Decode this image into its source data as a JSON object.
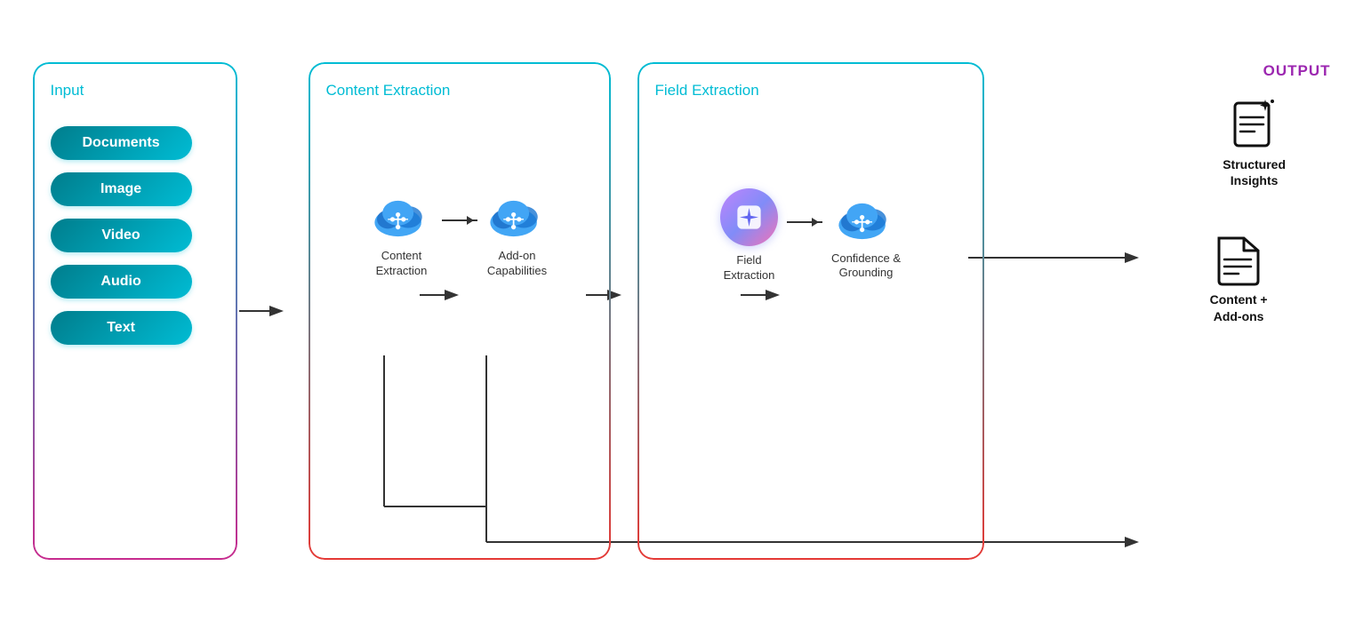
{
  "input": {
    "title": "Input",
    "items": [
      "Documents",
      "Image",
      "Video",
      "Audio",
      "Text"
    ]
  },
  "content_extraction": {
    "title": "Content Extraction",
    "steps": [
      {
        "label": "Content\nExtraction"
      },
      {
        "label": "Add-on\nCapabilities"
      }
    ]
  },
  "field_extraction": {
    "title": "Field Extraction",
    "steps": [
      {
        "label": "Field\nExtraction"
      },
      {
        "label": "Confidence &\nGrounding"
      }
    ]
  },
  "output": {
    "title": "OUTPUT",
    "items": [
      {
        "label": "Structured Insights"
      },
      {
        "label": "Content +\nAdd-ons"
      }
    ]
  }
}
